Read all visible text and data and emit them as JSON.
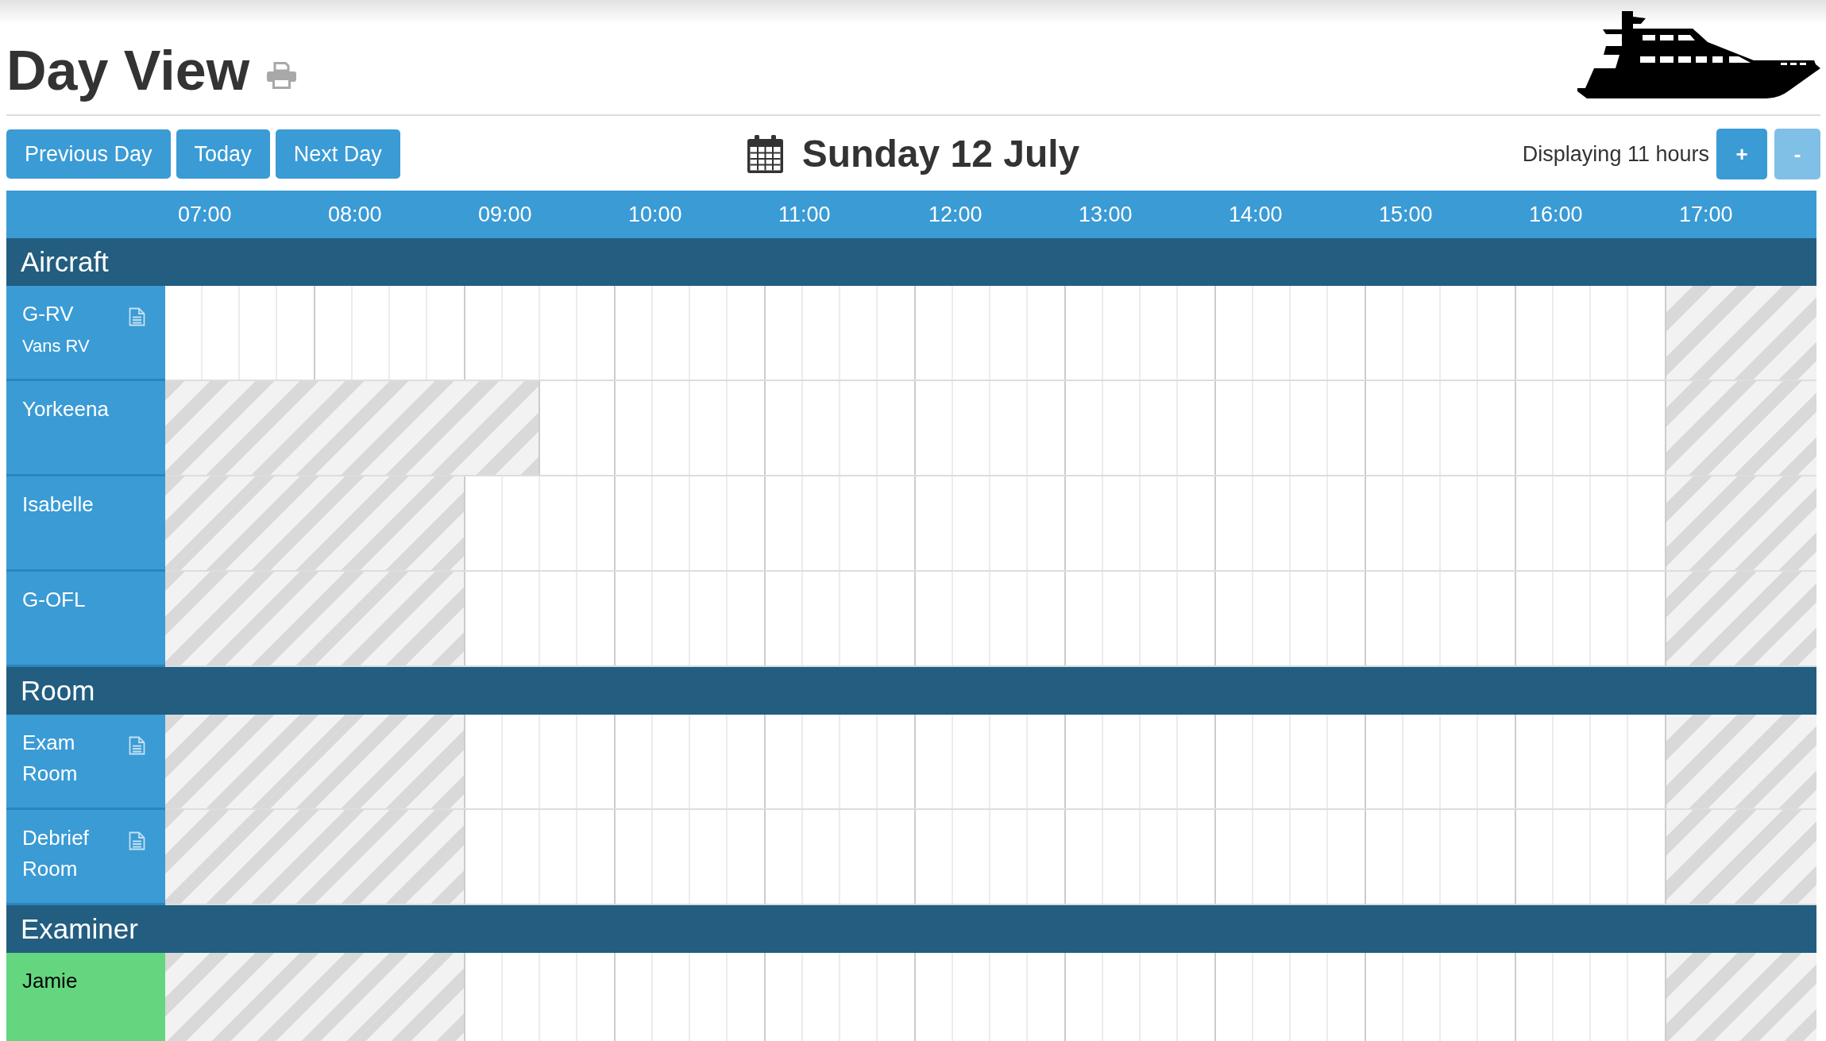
{
  "page": {
    "title": "Day View"
  },
  "toolbar": {
    "nav_buttons": [
      {
        "label": "Previous Day"
      },
      {
        "label": "Today"
      },
      {
        "label": "Next Day"
      }
    ],
    "date": "Sunday 12 July",
    "hours_display": "Displaying 11 hours",
    "zoom_buttons": [
      {
        "label": "+",
        "disabled": false
      },
      {
        "label": "-",
        "disabled": true
      }
    ]
  },
  "timeline": {
    "hours": [
      "07:00",
      "08:00",
      "09:00",
      "10:00",
      "11:00",
      "12:00",
      "13:00",
      "14:00",
      "15:00",
      "16:00",
      "17:00"
    ]
  },
  "sections": [
    {
      "title": "Aircraft",
      "rows": [
        {
          "name": "G-RV",
          "subtitle": "Vans RV",
          "has_notes": true,
          "color": "#3a9bd5",
          "unavailable": [
            false,
            false,
            false,
            false,
            false,
            false,
            false,
            false,
            false,
            false,
            false,
            false,
            false,
            false,
            false,
            false,
            false,
            false,
            false,
            false,
            false,
            false,
            false,
            false,
            false,
            false,
            false,
            false,
            false,
            false,
            false,
            false,
            false,
            false,
            false,
            false,
            false,
            false,
            false,
            false,
            true,
            true,
            true,
            true
          ]
        },
        {
          "name": "Yorkeena",
          "has_notes": false,
          "color": "#3a9bd5",
          "unavailable": [
            true,
            true,
            true,
            true,
            true,
            true,
            true,
            true,
            true,
            true,
            false,
            false,
            false,
            false,
            false,
            false,
            false,
            false,
            false,
            false,
            false,
            false,
            false,
            false,
            false,
            false,
            false,
            false,
            false,
            false,
            false,
            false,
            false,
            false,
            false,
            false,
            false,
            false,
            false,
            false,
            true,
            true,
            true,
            true
          ]
        },
        {
          "name": "Isabelle",
          "has_notes": false,
          "color": "#3a9bd5",
          "unavailable": [
            true,
            true,
            true,
            true,
            true,
            true,
            true,
            true,
            false,
            false,
            false,
            false,
            false,
            false,
            false,
            false,
            false,
            false,
            false,
            false,
            false,
            false,
            false,
            false,
            false,
            false,
            false,
            false,
            false,
            false,
            false,
            false,
            false,
            false,
            false,
            false,
            false,
            false,
            false,
            false,
            true,
            true,
            true,
            true
          ]
        },
        {
          "name": "G-OFL",
          "has_notes": false,
          "color": "#3a9bd5",
          "unavailable": [
            true,
            true,
            true,
            true,
            true,
            true,
            true,
            true,
            false,
            false,
            false,
            false,
            false,
            false,
            false,
            false,
            false,
            false,
            false,
            false,
            false,
            false,
            false,
            false,
            false,
            false,
            false,
            false,
            false,
            false,
            false,
            false,
            false,
            false,
            false,
            false,
            false,
            false,
            false,
            false,
            true,
            true,
            true,
            true
          ]
        }
      ]
    },
    {
      "title": "Room",
      "rows": [
        {
          "name": "Exam Room",
          "has_notes": true,
          "color": "#3a9bd5",
          "unavailable": [
            true,
            true,
            true,
            true,
            true,
            true,
            true,
            true,
            false,
            false,
            false,
            false,
            false,
            false,
            false,
            false,
            false,
            false,
            false,
            false,
            false,
            false,
            false,
            false,
            false,
            false,
            false,
            false,
            false,
            false,
            false,
            false,
            false,
            false,
            false,
            false,
            false,
            false,
            false,
            false,
            true,
            true,
            true,
            true
          ]
        },
        {
          "name": "Debrief Room",
          "has_notes": true,
          "color": "#3a9bd5",
          "unavailable": [
            true,
            true,
            true,
            true,
            true,
            true,
            true,
            true,
            false,
            false,
            false,
            false,
            false,
            false,
            false,
            false,
            false,
            false,
            false,
            false,
            false,
            false,
            false,
            false,
            false,
            false,
            false,
            false,
            false,
            false,
            false,
            false,
            false,
            false,
            false,
            false,
            false,
            false,
            false,
            false,
            true,
            true,
            true,
            true
          ]
        }
      ]
    },
    {
      "title": "Examiner",
      "rows": [
        {
          "name": "Jamie",
          "has_notes": false,
          "color": "#64d67f",
          "unavailable": [
            true,
            true,
            true,
            true,
            true,
            true,
            true,
            true,
            false,
            false,
            false,
            false,
            false,
            false,
            false,
            false,
            false,
            false,
            false,
            false,
            false,
            false,
            false,
            false,
            false,
            false,
            false,
            false,
            false,
            false,
            false,
            false,
            false,
            false,
            false,
            false,
            false,
            false,
            false,
            false,
            true,
            true,
            true,
            true
          ]
        }
      ]
    }
  ]
}
